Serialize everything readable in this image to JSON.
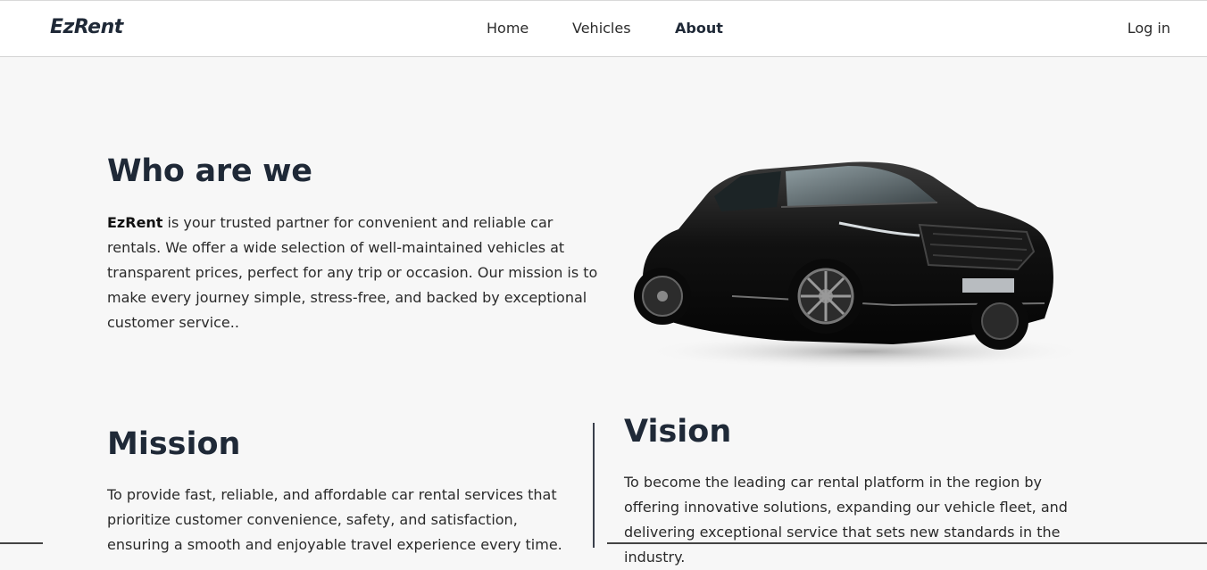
{
  "nav": {
    "brand": "EzRent",
    "links": [
      {
        "label": "Home"
      },
      {
        "label": "Vehicles"
      },
      {
        "label": "About"
      }
    ],
    "login": "Log in"
  },
  "who": {
    "title": "Who are we",
    "brand_bold": "EzRent",
    "text": " is your trusted partner for convenient and reliable car rentals. We offer a wide selection of well-maintained vehicles at transparent prices, perfect for any trip or occasion. Our mission is to make every journey simple, stress-free, and backed by exceptional customer service.."
  },
  "mission": {
    "title": "Mission",
    "text": "To provide fast, reliable, and affordable car rental services that prioritize customer convenience, safety, and satisfaction, ensuring a smooth and enjoyable travel experience every time."
  },
  "vision": {
    "title": "Vision",
    "text": "To become the leading car rental platform in the region by offering innovative solutions, expanding our vehicle fleet, and delivering exceptional service that sets new standards in the industry."
  },
  "colors": {
    "text_dark": "#1f2937",
    "background": "#f7f7f7",
    "navbar_bg": "#ffffff"
  }
}
